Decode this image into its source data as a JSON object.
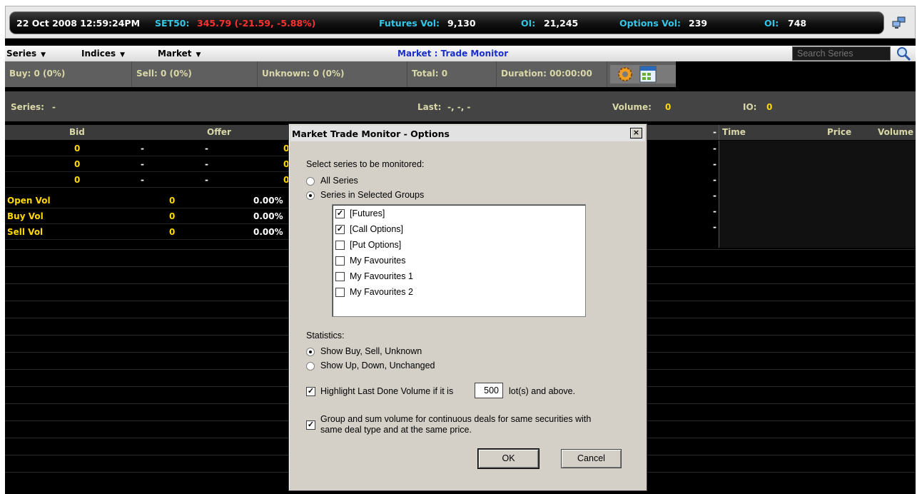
{
  "ticker": {
    "datetime": "22 Oct 2008 12:59:24PM",
    "set50_label": "SET50:",
    "set50_value": "345.79 (-21.59, -5.88%)",
    "futures_vol_label": "Futures Vol:",
    "futures_vol_value": "9,130",
    "oi1_label": "OI:",
    "oi1_value": "21,245",
    "options_vol_label": "Options Vol:",
    "options_vol_value": "239",
    "oi2_label": "OI:",
    "oi2_value": "748",
    "network_icon": "network-icon"
  },
  "menubar": {
    "series": "Series",
    "indices": "Indices",
    "market": "Market",
    "title": "Market : Trade Monitor",
    "search_placeholder": "Search Series"
  },
  "stats": {
    "buy": "Buy: 0 (0%)",
    "sell": "Sell: 0 (0%)",
    "unknown": "Unknown: 0 (0%)",
    "total": "Total: 0",
    "duration": "Duration: 00:00:00"
  },
  "series_row": {
    "series_label": "Series:",
    "series_value": "-",
    "last_label": "Last:",
    "last_value": "-, -, -",
    "volume_label": "Volume:",
    "volume_value": "0",
    "io_label": "IO:",
    "io_value": "0"
  },
  "depth": {
    "bid_header": "Bid",
    "offer_header": "Offer",
    "rows": [
      {
        "bid": "0",
        "c2": "-",
        "c3": "-",
        "offer": "0"
      },
      {
        "bid": "0",
        "c2": "-",
        "c3": "-",
        "offer": "0"
      },
      {
        "bid": "0",
        "c2": "-",
        "c3": "-",
        "offer": "0"
      }
    ],
    "right_dashes": [
      "-",
      "-",
      "-",
      "-",
      "-",
      "-",
      "-"
    ]
  },
  "volstats": [
    {
      "label": "Open Vol",
      "value": "0",
      "pct": "0.00%"
    },
    {
      "label": "Buy Vol",
      "value": "0",
      "pct": "0.00%"
    },
    {
      "label": "Sell Vol",
      "value": "0",
      "pct": "0.00%"
    }
  ],
  "trades": {
    "time": "Time",
    "price": "Price",
    "volume": "Volume"
  },
  "dialog": {
    "title": "Market Trade Monitor - Options",
    "close": "×",
    "select_label": "Select series to be monitored:",
    "all_series": "All Series",
    "series_in_groups": "Series in Selected Groups",
    "groups": [
      {
        "label": "[Futures]",
        "checked": true
      },
      {
        "label": "[Call Options]",
        "checked": true
      },
      {
        "label": "[Put Options]",
        "checked": false
      },
      {
        "label": "My Favourites",
        "checked": false
      },
      {
        "label": "My Favourites 1",
        "checked": false
      },
      {
        "label": "My Favourites 2",
        "checked": false
      }
    ],
    "statistics_label": "Statistics:",
    "show_buy_sell": "Show Buy, Sell, Unknown",
    "show_up_down": "Show Up, Down, Unchanged",
    "highlight_prefix": "Highlight Last Done Volume if it is",
    "highlight_value": "500",
    "highlight_suffix": "lot(s) and above.",
    "group_line1": "Group and sum volume for continuous deals for same securities with",
    "group_line2": "same deal type and at the same price.",
    "ok": "OK",
    "cancel": "Cancel"
  }
}
